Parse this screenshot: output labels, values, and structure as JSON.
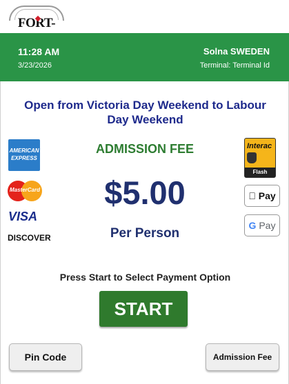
{
  "branding": {
    "logo_text": "FORT-ERIE"
  },
  "header": {
    "time": "11:28 AM",
    "date": "3/23/2026",
    "location": "Solna SWEDEN",
    "terminal": "Terminal: Terminal Id",
    "background_color": "#2a9447"
  },
  "main": {
    "notice": "Open from Victoria Day Weekend to Labour Day Weekend",
    "fee_label": "ADMISSION FEE",
    "price": "$5.00",
    "price_unit": "Per Person",
    "instruction": "Press Start to Select Payment Option"
  },
  "payment_logos": {
    "cards": [
      {
        "name": "american-express-logo",
        "label": "AMERICAN EXPRESS"
      },
      {
        "name": "mastercard-logo",
        "label": "MasterCard"
      },
      {
        "name": "visa-logo",
        "label": "VISA"
      },
      {
        "name": "discover-logo",
        "label": "DISCOVER"
      }
    ],
    "wallets": [
      {
        "name": "interac-flash-logo",
        "label": "Interac",
        "sublabel": "Flash"
      },
      {
        "name": "apple-pay-logo",
        "label": "Pay",
        "icon": "apple-icon"
      },
      {
        "name": "google-pay-logo",
        "label": "Pay",
        "icon": "google-g-icon"
      }
    ]
  },
  "buttons": {
    "start": "START",
    "pin_code": "Pin Code",
    "admission_fee": "Admission Fee"
  },
  "colors": {
    "accent_green": "#2e7d32",
    "start_button": "#2f7a2d",
    "navy_text": "#20306f",
    "notice_blue": "#1e2a8c"
  }
}
